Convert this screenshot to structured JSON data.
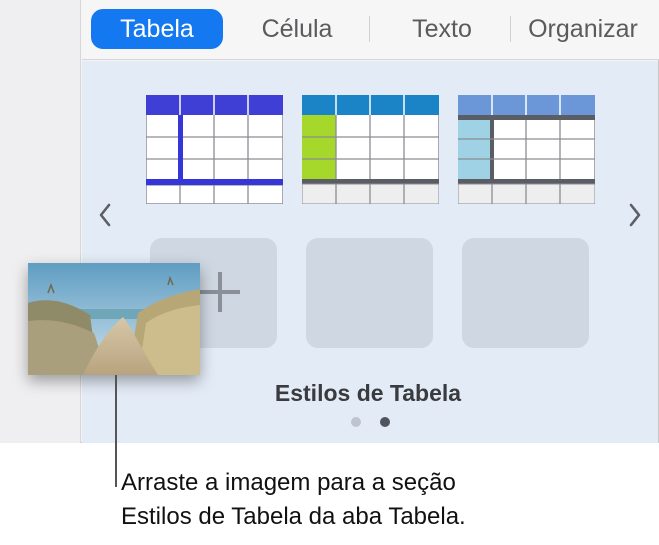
{
  "tabs": [
    {
      "label": "Tabela",
      "active": true
    },
    {
      "label": "Célula",
      "active": false
    },
    {
      "label": "Texto",
      "active": false
    },
    {
      "label": "Organizar",
      "active": false
    }
  ],
  "panel": {
    "title": "Estilos de Tabela",
    "prev_icon": "chevron-left-icon",
    "next_icon": "chevron-right-icon",
    "add_icon": "plus-icon",
    "page_count": 2,
    "current_page": 2
  },
  "table_styles": [
    {
      "name": "blue-style",
      "header_color": "#3f3fd6",
      "accent_color": "#3535d8"
    },
    {
      "name": "green-style",
      "header_color": "#1b84c7",
      "accent_color": "#a6d82c"
    },
    {
      "name": "light-blue-style",
      "header_color": "#6b97d8",
      "accent_color": "#9ed2e4"
    }
  ],
  "callout": {
    "line1": "Arraste a imagem para a seção",
    "line2": "Estilos de Tabela da aba Tabela."
  },
  "colors": {
    "accent": "#1478f0",
    "panel_bg": "#e3ebf6"
  }
}
